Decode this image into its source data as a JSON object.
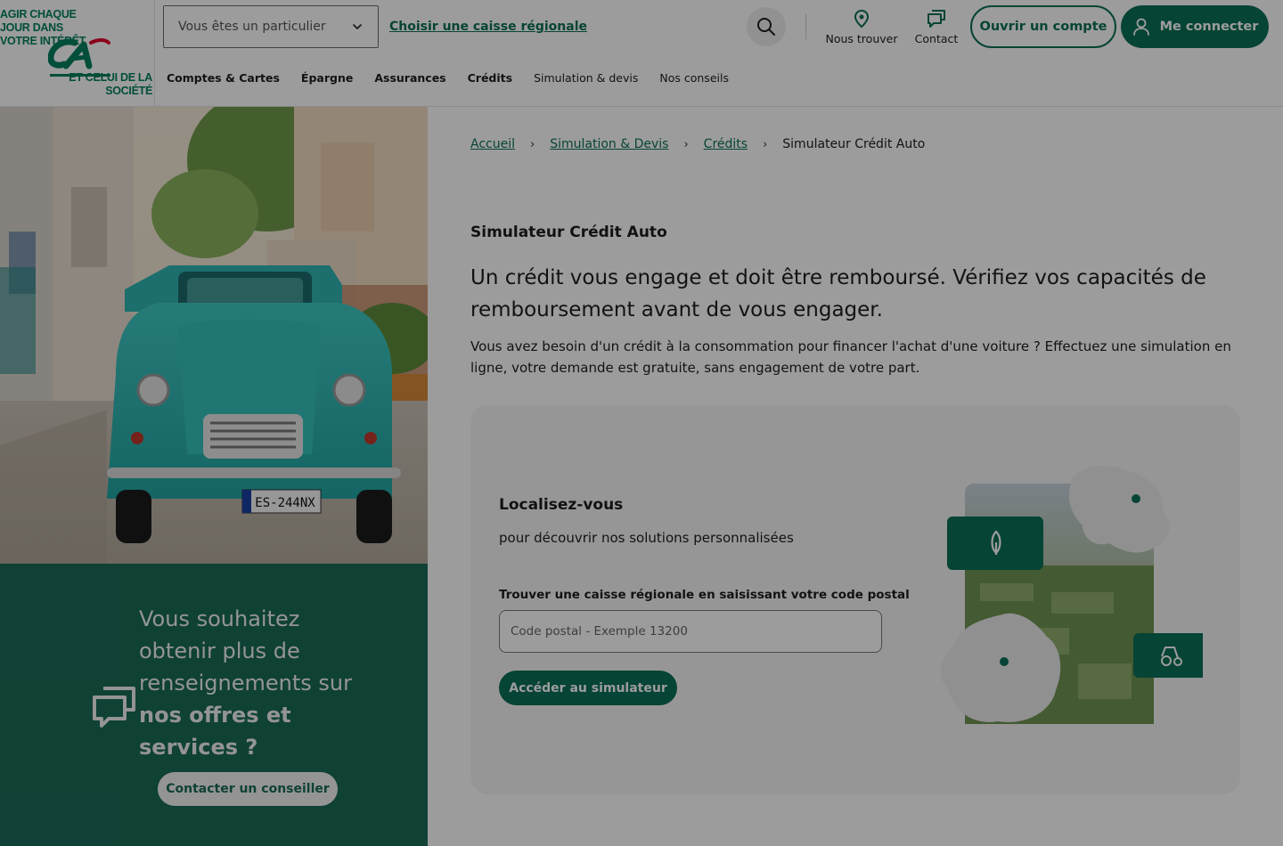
{
  "brand": {
    "tagline_top": "Agir chaque jour dans votre intérêt",
    "tagline_bottom": "et celui de la société",
    "logo_name": "credit-agricole-logo",
    "color_primary": "#0b6f58",
    "color_accent": "#e4002b"
  },
  "header": {
    "profile_select": {
      "value": "Vous êtes un particulier",
      "icon": "chevron-down-icon"
    },
    "caisse_link": "Choisir une caisse régionale",
    "search_icon": "search-icon",
    "find_label": "Nous trouver",
    "contact_label": "Contact",
    "open_account": "Ouvrir un compte",
    "login": "Me connecter",
    "nav": [
      {
        "label": "Comptes & Cartes"
      },
      {
        "label": "Épargne"
      },
      {
        "label": "Assurances"
      },
      {
        "label": "Crédits"
      },
      {
        "label": "Simulation & devis"
      },
      {
        "label": "Nos conseils"
      }
    ]
  },
  "promo": {
    "line1": "Vous souhaitez obtenir plus de renseignements sur",
    "line2": "nos offres et services ?",
    "button": "Contacter un conseiller",
    "background": "#1a6a58"
  },
  "breadcrumb": {
    "items": [
      "Accueil",
      "Simulation & Devis",
      "Crédits"
    ],
    "current": "Simulateur Crédit Auto",
    "separator": "›"
  },
  "main": {
    "title": "Simulateur Crédit Auto",
    "warning": "Un crédit vous engage et doit être remboursé. Vérifiez vos capacités de remboursement avant de vous engager.",
    "intro": "Vous avez besoin d'un crédit à la consommation pour financer l'achat d'une voiture ? Effectuez une simulation en ligne, votre demande est gratuite, sans engagement de votre part."
  },
  "locate": {
    "title": "Localisez-vous",
    "subtitle": "pour découvrir nos solutions personnalisées",
    "field_label": "Trouver une caisse régionale en saisissant votre code postal",
    "placeholder": "Code postal - Exemple 13200",
    "button": "Accéder au simulateur"
  },
  "hero_image": {
    "plate": "ES-244NX"
  }
}
